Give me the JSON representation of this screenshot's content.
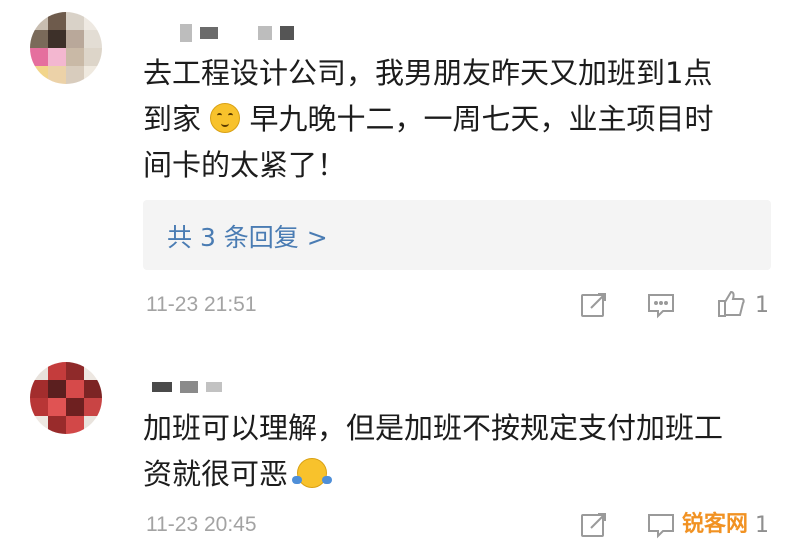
{
  "comments": [
    {
      "text_lines": [
        "去工程设计公司，我男朋友昨天又加班到1点",
        "到家",
        "早九晚十二，一周七天，业主项目时",
        "间卡的太紧了！"
      ],
      "emoji": "upside-down-face-icon",
      "replies_label": "共 3 条回复 >",
      "time": "11-23  21:51",
      "like_count": "1"
    },
    {
      "text_lines": [
        "加班可以理解，但是加班不按规定支付加班工",
        "资就很可恶"
      ],
      "emoji": "shrug-icon",
      "time": "11-23  20:45",
      "like_count": "1"
    }
  ],
  "watermark": "锐客网",
  "colors": {
    "link": "#4a7cb3",
    "meta": "#a3a3a3",
    "reply_bg": "#f4f4f4"
  }
}
